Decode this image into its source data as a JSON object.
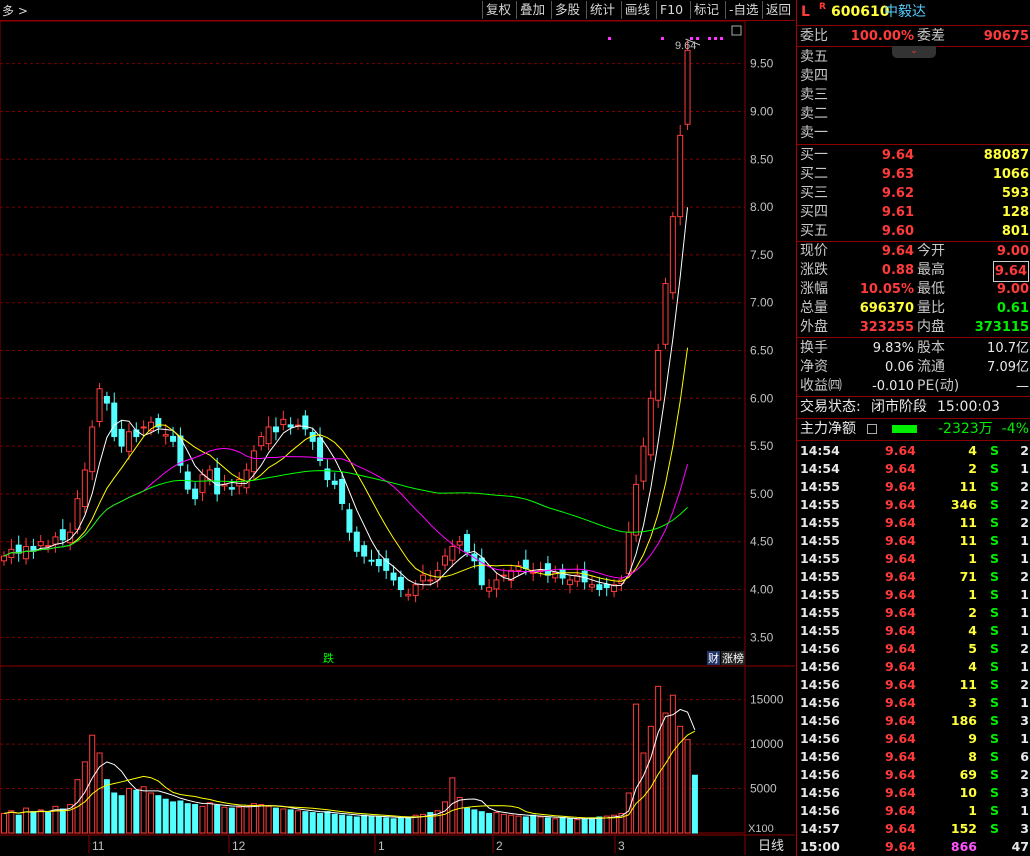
{
  "toolbar": {
    "left_text": "多 >",
    "buttons": [
      "复权",
      "叠加",
      "多股",
      "统计",
      "画线",
      "F10",
      "标记",
      "-自选",
      "返回"
    ]
  },
  "stock": {
    "mark": "L",
    "r": "R",
    "code": "600610",
    "name": "中毅达"
  },
  "order": {
    "ratio_label": "委比",
    "ratio": "100.00%",
    "diff_label": "委差",
    "diff": "90675"
  },
  "sell": [
    {
      "label": "卖五"
    },
    {
      "label": "卖四"
    },
    {
      "label": "卖三"
    },
    {
      "label": "卖二"
    },
    {
      "label": "卖一"
    }
  ],
  "buy": [
    {
      "label": "买一",
      "price": "9.64",
      "vol": "88087"
    },
    {
      "label": "买二",
      "price": "9.63",
      "vol": "1066"
    },
    {
      "label": "买三",
      "price": "9.62",
      "vol": "593"
    },
    {
      "label": "买四",
      "price": "9.61",
      "vol": "128"
    },
    {
      "label": "买五",
      "price": "9.60",
      "vol": "801"
    }
  ],
  "quote": [
    {
      "l1": "现价",
      "v1": "9.64",
      "l2": "今开",
      "v2": "9.00"
    },
    {
      "l1": "涨跌",
      "v1": "0.88",
      "l2": "最高",
      "v2": "9.64"
    },
    {
      "l1": "涨幅",
      "v1": "10.05%",
      "l2": "最低",
      "v2": "9.00"
    },
    {
      "l1": "总量",
      "v1": "696370",
      "l2": "量比",
      "v2": "0.61"
    },
    {
      "l1": "外盘",
      "v1": "323255",
      "l2": "内盘",
      "v2": "373115"
    }
  ],
  "fund": [
    {
      "l1": "换手",
      "v1": "9.83%",
      "l2": "股本",
      "v2": "10.7亿"
    },
    {
      "l1": "净资",
      "v1": "0.06",
      "l2": "流通",
      "v2": "7.09亿"
    },
    {
      "l1": "收益㈣",
      "v1": "-0.010",
      "l2": "PE(动)",
      "v2": "—"
    }
  ],
  "status": {
    "label": "交易状态:",
    "state": "闭市阶段",
    "time": "15:00:03"
  },
  "flow": {
    "label": "主力净额",
    "amount": "-2323万",
    "pct": "-4%"
  },
  "ticks": [
    [
      "14:54",
      "9.64",
      "4",
      "S",
      "2"
    ],
    [
      "14:54",
      "9.64",
      "2",
      "S",
      "1"
    ],
    [
      "14:55",
      "9.64",
      "11",
      "S",
      "2"
    ],
    [
      "14:55",
      "9.64",
      "346",
      "S",
      "2"
    ],
    [
      "14:55",
      "9.64",
      "11",
      "S",
      "2"
    ],
    [
      "14:55",
      "9.64",
      "11",
      "S",
      "1"
    ],
    [
      "14:55",
      "9.64",
      "1",
      "S",
      "1"
    ],
    [
      "14:55",
      "9.64",
      "71",
      "S",
      "2"
    ],
    [
      "14:55",
      "9.64",
      "1",
      "S",
      "1"
    ],
    [
      "14:55",
      "9.64",
      "2",
      "S",
      "1"
    ],
    [
      "14:55",
      "9.64",
      "4",
      "S",
      "1"
    ],
    [
      "14:56",
      "9.64",
      "5",
      "S",
      "2"
    ],
    [
      "14:56",
      "9.64",
      "4",
      "S",
      "1"
    ],
    [
      "14:56",
      "9.64",
      "11",
      "S",
      "2"
    ],
    [
      "14:56",
      "9.64",
      "3",
      "S",
      "1"
    ],
    [
      "14:56",
      "9.64",
      "186",
      "S",
      "3"
    ],
    [
      "14:56",
      "9.64",
      "9",
      "S",
      "1"
    ],
    [
      "14:56",
      "9.64",
      "8",
      "S",
      "6"
    ],
    [
      "14:56",
      "9.64",
      "69",
      "S",
      "2"
    ],
    [
      "14:56",
      "9.64",
      "10",
      "S",
      "3"
    ],
    [
      "14:56",
      "9.64",
      "1",
      "S",
      "1"
    ],
    [
      "14:57",
      "9.64",
      "152",
      "S",
      "3"
    ],
    [
      "15:00",
      "9.64",
      "866",
      "",
      ""
    ]
  ],
  "tick_last_extra": "47",
  "chart_data": {
    "type": "candlestick",
    "y_ticks": [
      "9.50",
      "9.00",
      "8.50",
      "8.00",
      "7.50",
      "7.00",
      "6.50",
      "6.00",
      "5.50",
      "5.00",
      "4.50",
      "4.00",
      "3.50"
    ],
    "vol_ticks": [
      "15000",
      "10000",
      "5000"
    ],
    "vol_unit": "X100",
    "x_labels": [
      "11",
      "12",
      "1",
      "2",
      "3"
    ],
    "period_label": "日线",
    "high_label": "9.64",
    "markers": [
      "跌",
      "财",
      "涨榜"
    ],
    "colors": {
      "up": "#ff3c3c",
      "down": "#54ffff",
      "ma5": "#ffffff",
      "ma10": "#ffff00",
      "ma20": "#ff00ff",
      "ma60": "#00ff00"
    },
    "closes": [
      4.35,
      4.42,
      4.38,
      4.45,
      4.4,
      4.5,
      4.46,
      4.55,
      4.52,
      4.6,
      4.95,
      5.25,
      5.7,
      6.1,
      5.95,
      5.6,
      5.5,
      5.65,
      5.6,
      5.7,
      5.75,
      5.7,
      5.62,
      5.55,
      5.3,
      5.05,
      4.95,
      5.2,
      5.25,
      5.0,
      5.1,
      5.05,
      5.15,
      5.25,
      5.45,
      5.6,
      5.7,
      5.65,
      5.78,
      5.7,
      5.72,
      5.68,
      5.55,
      5.35,
      5.15,
      5.1,
      4.9,
      4.6,
      4.4,
      4.35,
      4.3,
      4.25,
      4.2,
      4.1,
      4.0,
      3.95,
      4.05,
      4.15,
      4.1,
      4.2,
      4.35,
      4.45,
      4.5,
      4.4,
      4.3,
      4.05,
      4.02,
      4.1,
      4.15,
      4.2,
      4.25,
      4.22,
      4.18,
      4.2,
      4.15,
      4.18,
      4.12,
      4.1,
      4.15,
      4.08,
      4.05,
      4.0,
      4.02,
      4.05,
      4.1,
      4.6,
      5.1,
      5.5,
      6.0,
      6.5,
      7.2,
      7.9,
      8.75,
      9.64
    ],
    "volumes": [
      2200,
      2500,
      2000,
      2800,
      2400,
      2600,
      2300,
      3000,
      2700,
      3200,
      6000,
      8000,
      11000,
      9000,
      6000,
      4500,
      4200,
      5000,
      4800,
      5200,
      4500,
      4200,
      3800,
      3500,
      3600,
      3300,
      3200,
      3000,
      3400,
      3100,
      2900,
      2800,
      2900,
      3000,
      3300,
      3200,
      3000,
      2800,
      2700,
      2600,
      2500,
      2400,
      2300,
      2200,
      2400,
      2100,
      2000,
      1900,
      1800,
      2000,
      1900,
      1800,
      1700,
      1600,
      1700,
      1800,
      2000,
      2100,
      2300,
      2500,
      3500,
      6200,
      4000,
      2800,
      2600,
      2400,
      2200,
      2300,
      2100,
      2000,
      1900,
      1800,
      2000,
      1800,
      1700,
      1600,
      1700,
      1600,
      1500,
      1600,
      1700,
      1800,
      1900,
      2000,
      2200,
      4500,
      14500,
      9000,
      12000,
      16500,
      13500,
      15500,
      12000,
      10500,
      6500
    ]
  }
}
